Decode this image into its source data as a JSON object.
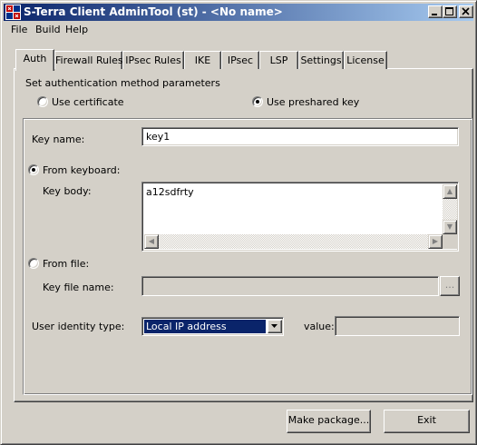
{
  "window": {
    "title": "S-Terra Client AdminTool (st) - <No name>",
    "controls": {
      "minimize": "_",
      "maximize": "□",
      "close": "✕"
    }
  },
  "menu": {
    "items": [
      "File",
      "Build",
      "Help"
    ]
  },
  "tabs": [
    "Auth",
    "Firewall Rules",
    "IPsec Rules",
    "IKE",
    "IPsec",
    "LSP",
    "Settings",
    "License"
  ],
  "auth": {
    "section_label": "Set authentication method parameters",
    "use_certificate": "Use certificate",
    "use_preshared_key": "Use preshared key",
    "selected_method": "preshared",
    "key_name_label": "Key name:",
    "key_name_value": "key1",
    "from_keyboard_label": "From keyboard:",
    "key_body_label": "Key body:",
    "key_body_value": "a12sdfrty",
    "from_file_label": "From file:",
    "key_file_name_label": "Key file name:",
    "key_file_name_value": "",
    "browse_button": "...",
    "user_identity_label": "User identity type:",
    "user_identity_value": "Local IP address",
    "value_label": "value:",
    "value_field": ""
  },
  "footer": {
    "make_package": "Make package...",
    "exit": "Exit"
  },
  "colors": {
    "face": "#d4d0c8",
    "title_start": "#0a246a",
    "title_end": "#a6caf0",
    "selection": "#0a246a"
  }
}
